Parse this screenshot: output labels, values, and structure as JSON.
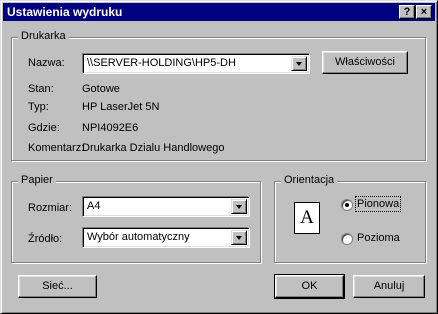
{
  "window": {
    "title": "Ustawienia wydruku",
    "help_button": "?",
    "close_button": "×"
  },
  "printer": {
    "group_label": "Drukarka",
    "name_label": "Nazwa:",
    "name_value": "\\\\SERVER-HOLDING\\HP5-DH",
    "properties_button": "Właściwości",
    "status_label": "Stan:",
    "status_value": "Gotowe",
    "type_label": "Typ:",
    "type_value": "HP LaserJet 5N",
    "where_label": "Gdzie:",
    "where_value": "NPI4092E6",
    "comment_label": "Komentarz:",
    "comment_value": "Drukarka Dzialu Handlowego"
  },
  "paper": {
    "group_label": "Papier",
    "size_label": "Rozmiar:",
    "size_value": "A4",
    "source_label": "Źródło:",
    "source_value": "Wybór automatyczny"
  },
  "orientation": {
    "group_label": "Orientacja",
    "icon_letter": "A",
    "portrait_label": "Pionowa",
    "landscape_label": "Pozioma",
    "selected": "portrait"
  },
  "buttons": {
    "network": "Sieć...",
    "ok": "OK",
    "cancel": "Anuluj"
  }
}
